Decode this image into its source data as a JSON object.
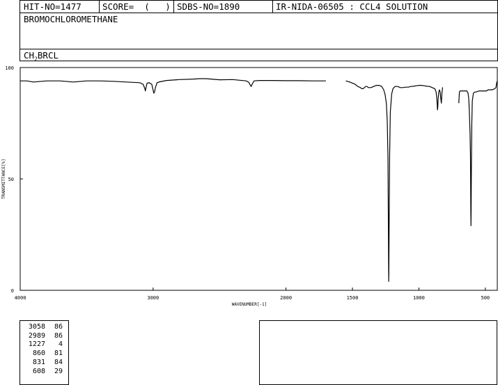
{
  "header": {
    "hit_no": "HIT-NO=1477",
    "score": "SCORE=  (   )",
    "sdbs_no": "SDBS-NO=1890",
    "ir_info": "IR-NIDA-06505 : CCL4 SOLUTION"
  },
  "compound_name": "BROMOCHLOROMETHANE",
  "formula": {
    "main": "CH",
    "sub": "2",
    "rest": "BRCL"
  },
  "chart_data": {
    "type": "line",
    "xlabel": "WAVENUMBER[-1]",
    "ylabel": "TRANSMITTANCE[%]",
    "xlim": [
      4000,
      410
    ],
    "ylim": [
      0,
      100
    ],
    "xticks": [
      4000,
      3000,
      2000,
      1500,
      1000,
      500
    ],
    "yticks": [
      0,
      50,
      100
    ],
    "series": [
      {
        "x": [
          4000,
          3950,
          3900,
          3800,
          3700,
          3600,
          3500,
          3400,
          3300,
          3200,
          3100,
          3075,
          3062,
          3058,
          3054,
          3045,
          3030,
          3010,
          2995,
          2989,
          2983,
          2970,
          2950,
          2900,
          2800,
          2700,
          2650,
          2600,
          2500,
          2400,
          2300,
          2280,
          2270,
          2262,
          2255,
          2240,
          2200,
          2100,
          2000,
          1900,
          1800,
          1700
        ],
        "y": [
          94,
          94,
          93.5,
          94,
          94,
          93.5,
          94,
          94,
          93.8,
          93.5,
          93.2,
          92.5,
          90.5,
          89.5,
          90.8,
          93,
          93.2,
          92.5,
          88.5,
          89,
          91,
          93.2,
          93.6,
          94.2,
          94.6,
          94.8,
          95,
          95,
          94.5,
          94.6,
          94,
          93.4,
          92.2,
          91.5,
          92.5,
          94,
          94.2,
          94.2,
          94.1,
          94.1,
          94,
          94
        ]
      },
      {
        "x": [
          1550,
          1520,
          1500,
          1480,
          1460,
          1440,
          1430,
          1420,
          1410,
          1400,
          1390,
          1380,
          1360,
          1340,
          1320,
          1300,
          1280,
          1265,
          1255,
          1245,
          1238,
          1233,
          1230,
          1228,
          1227,
          1226,
          1224,
          1220,
          1215,
          1205,
          1195,
          1180,
          1160,
          1140,
          1120,
          1100,
          1080,
          1060,
          1040,
          1020,
          1000,
          980,
          960,
          940,
          920,
          900,
          880,
          870,
          865,
          862,
          860,
          858,
          855,
          850,
          845,
          840,
          835,
          831,
          827,
          822,
          820
        ],
        "y": [
          94,
          93.5,
          93,
          92.5,
          91.5,
          91,
          90.5,
          90.5,
          91,
          91.5,
          91.5,
          91,
          91,
          91.5,
          92,
          92,
          91.5,
          90,
          88,
          84,
          76,
          60,
          35,
          15,
          4,
          8,
          30,
          60,
          80,
          88,
          90.5,
          91.5,
          91.5,
          91,
          91,
          91.2,
          91.2,
          91.5,
          91.6,
          91.8,
          92,
          92,
          91.8,
          91.6,
          91.5,
          91,
          90.5,
          89,
          86,
          83,
          81,
          82,
          86,
          89,
          90,
          89,
          86,
          84,
          88,
          91,
          91
        ]
      },
      {
        "x": [
          700,
          695,
          690,
          680,
          670,
          660,
          650,
          640,
          630,
          625,
          620,
          615,
          612,
          610,
          609,
          608,
          607,
          605,
          602,
          598,
          590,
          580,
          570,
          560,
          550,
          540,
          530,
          520,
          510,
          500,
          490,
          480,
          470,
          460,
          450,
          440,
          430,
          420,
          415,
          410
        ],
        "y": [
          84,
          89,
          89.5,
          89.5,
          89.5,
          89.5,
          89.5,
          89.5,
          88.5,
          86,
          80,
          70,
          60,
          45,
          35,
          29,
          36,
          55,
          75,
          85,
          88.5,
          89,
          89,
          89.2,
          89.5,
          89.5,
          89.5,
          89.5,
          89.5,
          89.5,
          89.5,
          90,
          90,
          90,
          90,
          90.2,
          90.5,
          91,
          93,
          94
        ]
      }
    ]
  },
  "peaks": [
    {
      "x": "3058",
      "y": "86"
    },
    {
      "x": "2989",
      "y": "86"
    },
    {
      "x": "1227",
      "y": "4"
    },
    {
      "x": "860",
      "y": "81"
    },
    {
      "x": "831",
      "y": "84"
    },
    {
      "x": "608",
      "y": "29"
    }
  ]
}
